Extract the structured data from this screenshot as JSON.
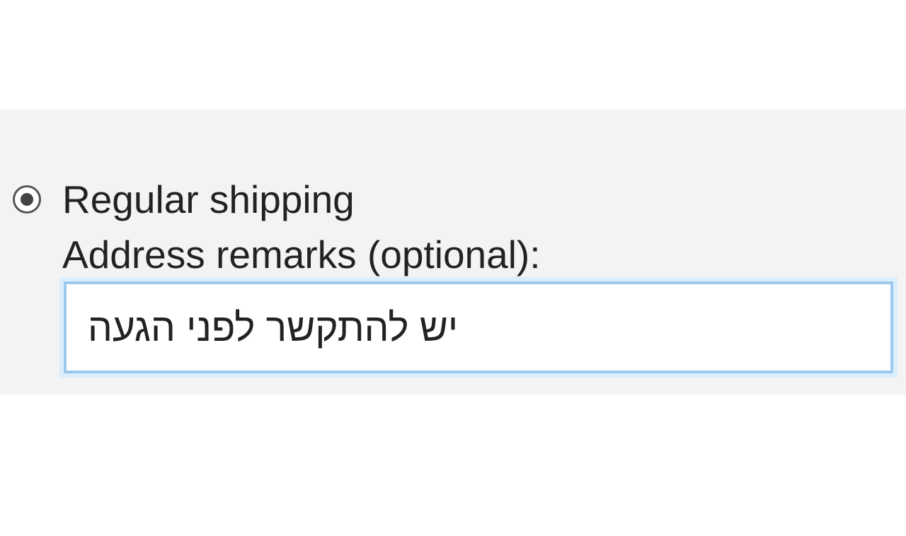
{
  "shipping": {
    "radio_label": "Regular shipping",
    "remark_label": "Address remarks (optional):",
    "remark_value": "יש להתקשר לפני הגעה"
  }
}
